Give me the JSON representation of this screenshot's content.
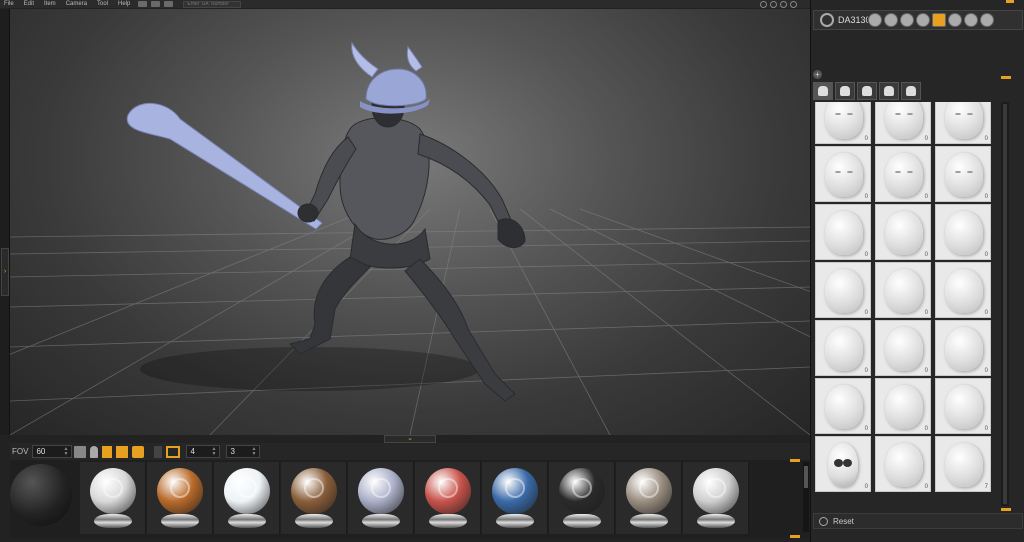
{
  "menu": {
    "items": [
      "File",
      "Edit",
      "Item",
      "Camera",
      "Tool",
      "Help"
    ],
    "da_input_placeholder": "Enter 'DA' Number"
  },
  "viewport": {
    "collapse_side_icon": "chevron-right-icon",
    "collapse_bottom_icon": "chevron-down-icon"
  },
  "toolbar": {
    "fov_label": "FOV",
    "fov_value": "60",
    "field_a_value": "4",
    "field_b_value": "3"
  },
  "materials": {
    "items": [
      {
        "name": "dark-sphere",
        "color": "#222222"
      },
      {
        "name": "chrome",
        "color": "#d9d9d9"
      },
      {
        "name": "copper",
        "color": "#b86a2a"
      },
      {
        "name": "pearl",
        "color": "#eef3f6"
      },
      {
        "name": "bronze",
        "color": "#8a5e3a"
      },
      {
        "name": "steel-blue",
        "color": "#aab0c8"
      },
      {
        "name": "red",
        "color": "#c8534b"
      },
      {
        "name": "blue-gold",
        "color": "#3a6aa8"
      },
      {
        "name": "black-white",
        "color": "#2a2a2a"
      },
      {
        "name": "taupe",
        "color": "#9a8e80"
      },
      {
        "name": "silver",
        "color": "#cfcfcf"
      }
    ]
  },
  "right_panel": {
    "model_name": "DA3130",
    "accent_color": "#e8a020",
    "tabs": [
      "head-tab",
      "helmet-tab",
      "hat-tab",
      "boot-tab",
      "tent-tab"
    ],
    "thumb_counts": [
      "0",
      "0",
      "0",
      "0",
      "0",
      "0",
      "0",
      "0",
      "0",
      "0",
      "0",
      "0",
      "0",
      "0",
      "0",
      "0",
      "0",
      "0",
      "0",
      "0",
      "7"
    ],
    "reset_label": "Reset"
  }
}
